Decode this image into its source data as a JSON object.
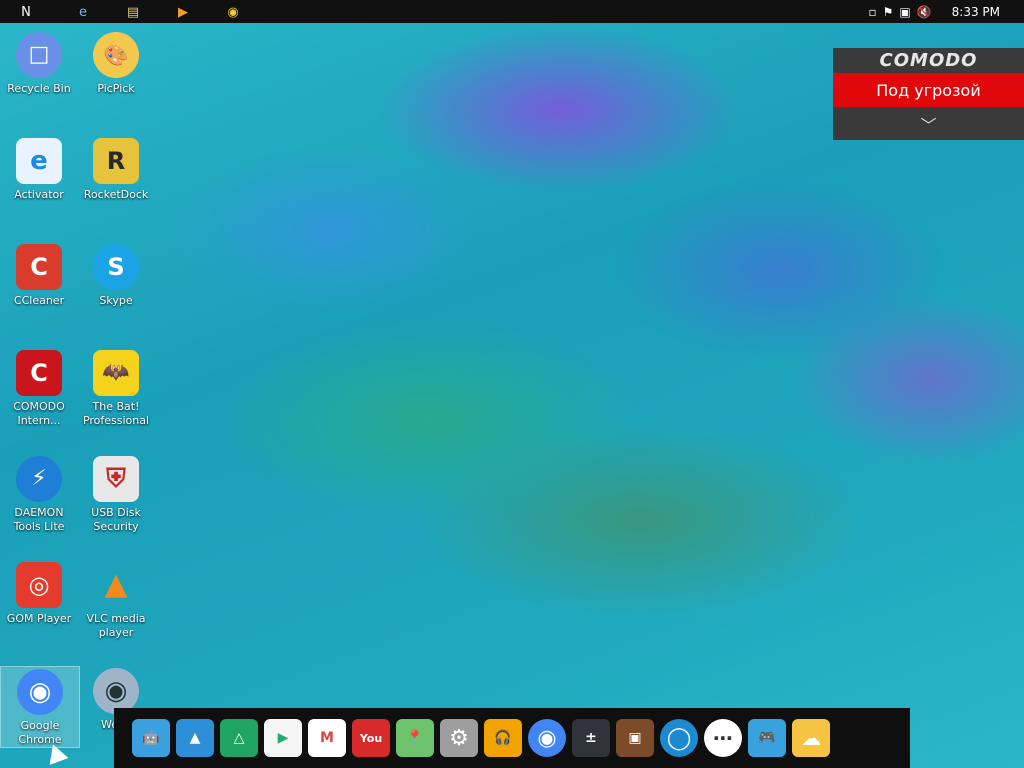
{
  "topbar": {
    "quick_launch": [
      {
        "name": "nexus-logo-icon",
        "glyph": "N"
      },
      {
        "name": "ie-icon",
        "glyph": "e"
      },
      {
        "name": "file-manager-icon",
        "glyph": "▤"
      },
      {
        "name": "media-player-icon",
        "glyph": "▶"
      },
      {
        "name": "chrome-icon",
        "glyph": "◉"
      }
    ],
    "tray": [
      {
        "name": "tray-dot-icon",
        "glyph": "▫"
      },
      {
        "name": "action-center-flag-icon",
        "glyph": "⚑"
      },
      {
        "name": "network-icon",
        "glyph": "▣"
      },
      {
        "name": "volume-muted-icon",
        "glyph": "🔇"
      }
    ],
    "clock": "8:33 PM"
  },
  "desktop": {
    "icons": [
      {
        "label": "Recycle Bin",
        "glyph": "□",
        "bg": "#6a8fe8"
      },
      {
        "label": "PicPick",
        "glyph": "🎨",
        "bg": "#f2c94c"
      },
      {
        "label": "Activator",
        "glyph": "e",
        "bg": "#e9f2ff"
      },
      {
        "label": "RocketDock",
        "glyph": "R",
        "bg": "#e5c33a"
      },
      {
        "label": "CCleaner",
        "glyph": "C",
        "bg": "#d93b2c"
      },
      {
        "label": "Skype",
        "glyph": "S",
        "bg": "#1aa4e6"
      },
      {
        "label": "COMODO Intern...",
        "glyph": "C",
        "bg": "#c9151b"
      },
      {
        "label": "The Bat! Professional",
        "glyph": "🦇",
        "bg": "#f5d31d"
      },
      {
        "label": "DAEMON Tools Lite",
        "glyph": "⚡",
        "bg": "#1f7fd6"
      },
      {
        "label": "USB Disk Security",
        "glyph": "⛨",
        "bg": "#e8e8e8"
      },
      {
        "label": "GOM Player",
        "glyph": "◎",
        "bg": "#e53b2e"
      },
      {
        "label": "VLC media player",
        "glyph": "▲",
        "bg": "#f28b1c"
      },
      {
        "label": "Google Chrome",
        "glyph": "◉",
        "bg": "#4285f4"
      },
      {
        "label": "Webc",
        "glyph": "◉",
        "bg": "#9fb4c9"
      }
    ]
  },
  "comodo_widget": {
    "title": "COMODO",
    "status": "Под угрозой",
    "chevron": "﹀"
  },
  "dock": {
    "items": [
      {
        "name": "android-folder",
        "glyph": "🤖",
        "bg": "#3aa0e0"
      },
      {
        "name": "drive-folder",
        "glyph": "▲",
        "bg": "#2d8fd8"
      },
      {
        "name": "google-drive",
        "glyph": "△",
        "bg": "#1fa463"
      },
      {
        "name": "play-store",
        "glyph": "▶",
        "bg": "#f5f5f5"
      },
      {
        "name": "gmail",
        "glyph": "M",
        "bg": "#ffffff"
      },
      {
        "name": "youtube",
        "glyph": "You",
        "bg": "#d72b2b"
      },
      {
        "name": "maps",
        "glyph": "📍",
        "bg": "#6cc36c"
      },
      {
        "name": "settings",
        "glyph": "⚙",
        "bg": "#9e9e9e"
      },
      {
        "name": "music",
        "glyph": "🎧",
        "bg": "#f2a300"
      },
      {
        "name": "chrome",
        "glyph": "◉",
        "bg": "#4285f4"
      },
      {
        "name": "calculator",
        "glyph": "±",
        "bg": "#30343a"
      },
      {
        "name": "gallery",
        "glyph": "▣",
        "bg": "#7b4b2a"
      },
      {
        "name": "search",
        "glyph": "◯",
        "bg": "#1c8ad1"
      },
      {
        "name": "apps-grid",
        "glyph": "⋯",
        "bg": "#ffffff"
      },
      {
        "name": "games-folder",
        "glyph": "🎮",
        "bg": "#37a2dd"
      },
      {
        "name": "weather",
        "glyph": "☁",
        "bg": "#f6c343"
      }
    ]
  }
}
